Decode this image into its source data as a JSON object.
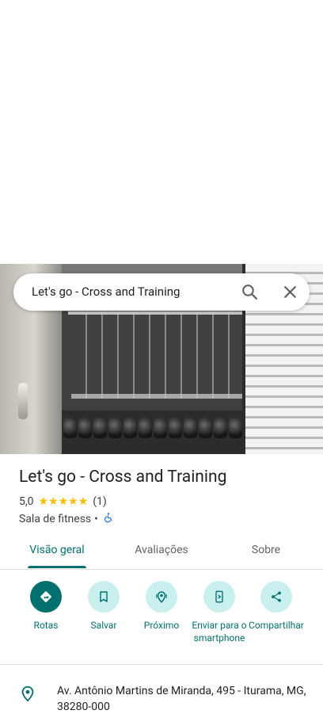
{
  "search": {
    "query": "Let's go - Cross and Training"
  },
  "place": {
    "title": "Let's go - Cross and Training",
    "rating": "5,0",
    "stars": "★★★★★",
    "reviews_count": "(1)",
    "category": "Sala de fitness",
    "separator": "•",
    "accessibility_icon": "wheelchair-icon"
  },
  "tabs": [
    {
      "label": "Visão geral",
      "active": true
    },
    {
      "label": "Avaliações",
      "active": false
    },
    {
      "label": "Sobre",
      "active": false
    }
  ],
  "actions": [
    {
      "label": "Rotas",
      "icon": "directions-icon"
    },
    {
      "label": "Salvar",
      "icon": "bookmark-icon"
    },
    {
      "label": "Próximo",
      "icon": "nearby-icon"
    },
    {
      "label": "Enviar para o smartphone",
      "icon": "send-to-phone-icon"
    },
    {
      "label": "Compartilhar",
      "icon": "share-icon"
    }
  ],
  "address": {
    "text": "Av. Antônio Martins de Miranda, 495 - Iturama, MG, 38280-000",
    "icon": "location-pin-icon"
  },
  "colors": {
    "accent": "#01706f",
    "accent_light": "#c9f0ef",
    "star": "#fbbc04"
  }
}
